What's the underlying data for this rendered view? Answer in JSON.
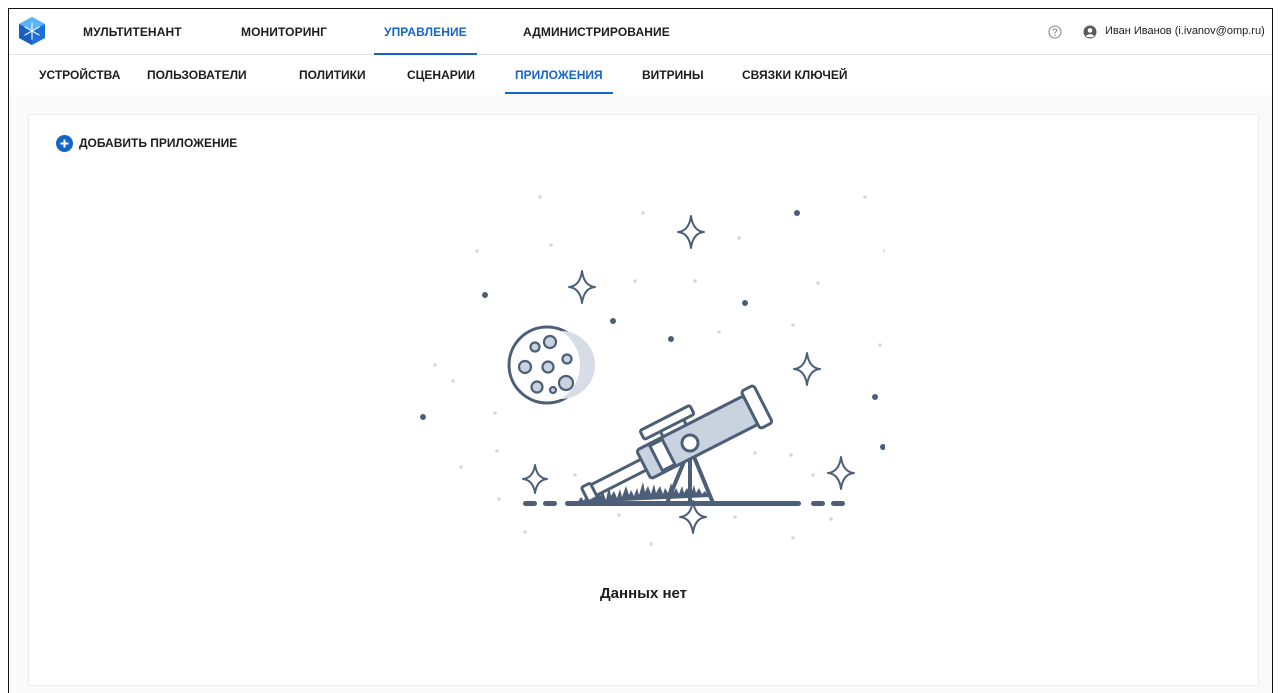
{
  "header": {
    "tabs": [
      {
        "label": "МУЛЬТИТЕНАНТ",
        "active": false
      },
      {
        "label": "МОНИТОРИНГ",
        "active": false
      },
      {
        "label": "УПРАВЛЕНИЕ",
        "active": true
      },
      {
        "label": "АДМИНИСТРИРОВАНИЕ",
        "active": false
      }
    ],
    "user_name": "Иван Иванов (i.ivanov@omp.ru)",
    "icons": {
      "help": "help-icon",
      "user": "user-icon",
      "logo": "logo-icon"
    }
  },
  "subnav": {
    "tabs": [
      {
        "label": "УСТРОЙСТВА",
        "active": false
      },
      {
        "label": "ПОЛЬЗОВАТЕЛИ",
        "active": false
      },
      {
        "label": "ПОЛИТИКИ",
        "active": false
      },
      {
        "label": "СЦЕНАРИИ",
        "active": false
      },
      {
        "label": "ПРИЛОЖЕНИЯ",
        "active": true
      },
      {
        "label": "ВИТРИНЫ",
        "active": false
      },
      {
        "label": "СВЯЗКИ КЛЮЧЕЙ",
        "active": false
      }
    ]
  },
  "main": {
    "add_button_label": "ДОБАВИТЬ ПРИЛОЖЕНИЕ",
    "empty_state_text": "Данных нет",
    "illustration": "telescope-moon-stars"
  },
  "colors": {
    "accent": "#1565c8",
    "illustration": "#4d5f78",
    "illustration_light": "#c9d3df"
  }
}
